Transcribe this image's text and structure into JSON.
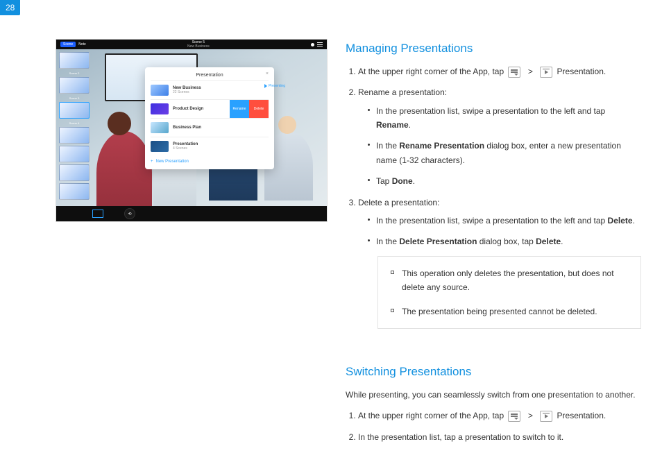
{
  "page_number": "28",
  "screenshot": {
    "topbar": {
      "scene_btn": "Scene",
      "note_btn": "Note",
      "title_line1": "Scene 5",
      "title_line2": "New Business"
    },
    "thumbs": [
      {
        "label": "Scene 2"
      },
      {
        "label": "Scene 3"
      },
      {
        "label": "Scene 4"
      },
      {
        "label": ""
      },
      {
        "label": ""
      },
      {
        "label": ""
      },
      {
        "label": ""
      },
      {
        "label": ""
      }
    ],
    "panel": {
      "title": "Presentation",
      "presenting_label": "Presenting",
      "rows": [
        {
          "title": "New Business",
          "sub": "22 Scenes"
        },
        {
          "title": "Product Design",
          "sub": ""
        },
        {
          "title": "Business Plan",
          "sub": ""
        },
        {
          "title": "Presentation",
          "sub": "4 Scenes"
        }
      ],
      "rename_label": "Rename",
      "delete_label": "Delete",
      "add_label": "New Presentation"
    }
  },
  "section1": {
    "title": "Managing Presentations",
    "step1_pre": "At the upper right corner of the App, tap",
    "step1_gt": ">",
    "step1_post": "Presentation.",
    "step2": "Rename a presentation:",
    "s2a_pre": "In the presentation list, swipe a presentation to the left and tap",
    "s2a_bold": "Rename",
    "s2a_post": ".",
    "s2b_pre": "In the ",
    "s2b_bold": "Rename Presentation",
    "s2b_post": " dialog box, enter a new presentation name (1-32 characters).",
    "s2c_pre": "Tap ",
    "s2c_bold": "Done",
    "s2c_post": ".",
    "step3": "Delete a presentation:",
    "s3a_pre": "In the presentation list, swipe a presentation to the left and tap ",
    "s3a_bold": "Delete",
    "s3a_post": ".",
    "s3b_pre": "In the ",
    "s3b_bold": "Delete Presentation",
    "s3b_mid": " dialog box, tap ",
    "s3b_bold2": "Delete",
    "s3b_post": ".",
    "note1": "This operation only deletes the presentation, but does not delete any source.",
    "note2": "The presentation being presented cannot be deleted."
  },
  "section2": {
    "title": "Switching Presentations",
    "intro": "While presenting, you can seamlessly switch from one presentation to another.",
    "step1_pre": "At the upper right corner of the App, tap",
    "step1_gt": ">",
    "step1_post": "Presentation.",
    "step2": "In the presentation list, tap a presentation to switch to it."
  }
}
